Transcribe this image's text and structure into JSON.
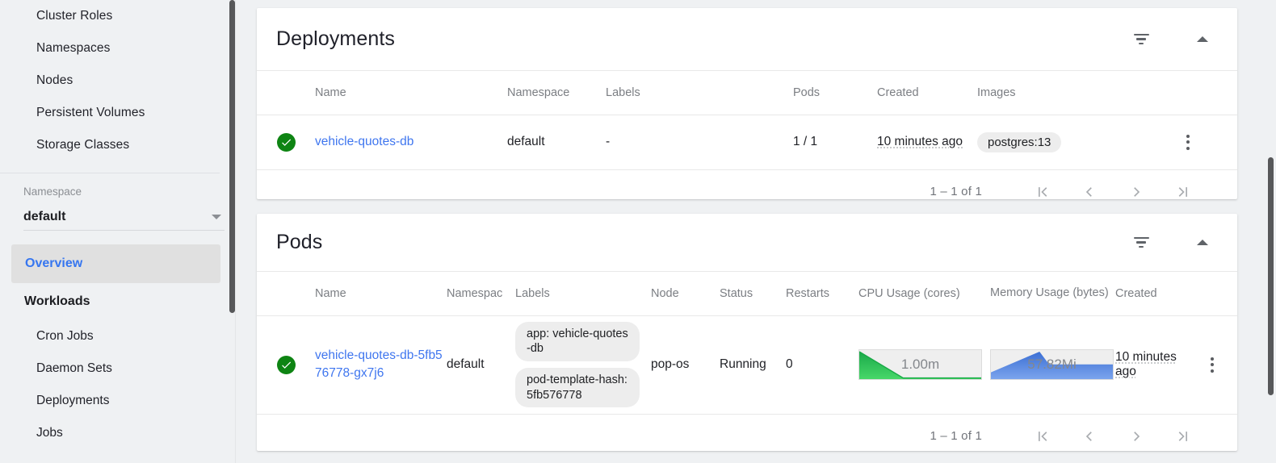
{
  "sidebar": {
    "cluster_items": [
      {
        "label": "Cluster Roles"
      },
      {
        "label": "Namespaces"
      },
      {
        "label": "Nodes"
      },
      {
        "label": "Persistent Volumes"
      },
      {
        "label": "Storage Classes"
      }
    ],
    "namespace_label": "Namespace",
    "namespace_value": "default",
    "overview_label": "Overview",
    "workloads_label": "Workloads",
    "workload_items": [
      {
        "label": "Cron Jobs"
      },
      {
        "label": "Daemon Sets"
      },
      {
        "label": "Deployments"
      },
      {
        "label": "Jobs"
      }
    ]
  },
  "deployments": {
    "title": "Deployments",
    "filter_icon": "filter-icon",
    "collapse_icon": "caret-up-icon",
    "columns": [
      "",
      "Name",
      "Namespace",
      "Labels",
      "Pods",
      "Created",
      "Images",
      ""
    ],
    "rows": [
      {
        "status_icon": "check-circle-icon",
        "status_color": "#0e8413",
        "name": "vehicle-quotes-db",
        "namespace": "default",
        "labels": "-",
        "pods": "1 / 1",
        "created": "10 minutes ago",
        "images": "postgres:13",
        "menu_icon": "kebab-menu-icon"
      }
    ],
    "pager": {
      "count": "1 – 1 of 1",
      "first_label": "|<",
      "prev_label": "<",
      "next_label": ">",
      "last_label": ">|"
    }
  },
  "pods": {
    "title": "Pods",
    "filter_icon": "filter-icon",
    "collapse_icon": "caret-up-icon",
    "columns": [
      "",
      "Name",
      "Namespac",
      "Labels",
      "Node",
      "Status",
      "Restarts",
      "CPU Usage (cores)",
      "Memory Usage (bytes)",
      "Created",
      ""
    ],
    "rows": [
      {
        "status_icon": "check-circle-icon",
        "status_color": "#0e8413",
        "name": "vehicle-quotes-db-5fb576778-gx7j6",
        "namespace": "default",
        "labels": [
          "app: vehicle-quotes-db",
          "pod-template-hash: 5fb576778"
        ],
        "node": "pop-os",
        "status": "Running",
        "restarts": "0",
        "cpu_value": "1.00m",
        "cpu_color": "#2fbb4f",
        "memory_value": "57.82Mi",
        "memory_color": "#4a7fe0",
        "created": "10 minutes ago",
        "menu_icon": "kebab-menu-icon"
      }
    ],
    "pager": {
      "count": "1 – 1 of 1",
      "first_label": "|<",
      "prev_label": "<",
      "next_label": ">",
      "last_label": ">|"
    }
  },
  "chart_data": [
    {
      "type": "area",
      "title": "CPU Usage (cores)",
      "label": "1.00m",
      "color": "#2fbb4f",
      "x": [
        0,
        10,
        20,
        30,
        40,
        50,
        60,
        70,
        80,
        90,
        100
      ],
      "values": [
        1.0,
        0.72,
        0.44,
        0.17,
        0.02,
        0.02,
        0.02,
        0.02,
        0.02,
        0.02,
        0.02
      ],
      "ylim": [
        0,
        1.0
      ],
      "grid": false
    },
    {
      "type": "area",
      "title": "Memory Usage (bytes)",
      "label": "57.82Mi",
      "color": "#4a7fe0",
      "x": [
        0,
        10,
        20,
        30,
        40,
        50,
        60,
        70,
        80,
        90,
        100
      ],
      "values": [
        0.28,
        0.48,
        0.68,
        0.88,
        1.0,
        0.62,
        0.58,
        0.58,
        0.58,
        0.58,
        0.58
      ],
      "ylim": [
        0,
        1.0
      ],
      "grid": false
    }
  ]
}
